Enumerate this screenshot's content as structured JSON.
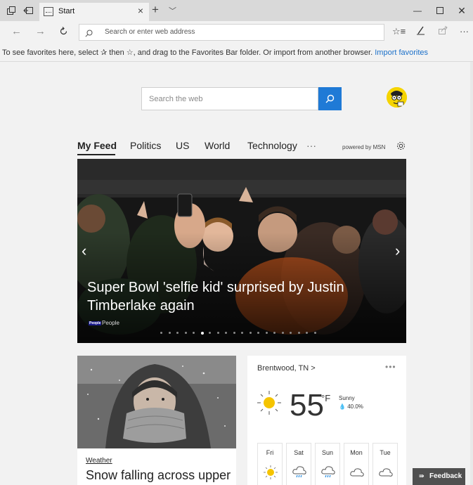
{
  "tab": {
    "title": "Start"
  },
  "address": {
    "placeholder": "Search or enter web address"
  },
  "favbar": {
    "text": "To see favorites here, select ✰ then ☆, and drag to the Favorites Bar folder. Or import from another browser.",
    "link": "Import favorites"
  },
  "search": {
    "placeholder": "Search the web"
  },
  "feed": {
    "tabs": [
      "My Feed",
      "Politics",
      "US",
      "World",
      "Technology",
      "···"
    ],
    "powered": "powered by MSN"
  },
  "hero": {
    "headline": "Super Bowl 'selfie kid' surprised by Justin Timberlake again",
    "source_logo": "People",
    "source": "People",
    "slide_count": 20,
    "active_slide": 5
  },
  "news_card": {
    "category": "Weather",
    "title": "Snow falling across upper"
  },
  "weather": {
    "location": "Brentwood, TN >",
    "more": "•••",
    "temp": "55",
    "unit": "°F",
    "condition": "Sunny",
    "precip": "40.0%",
    "forecast": [
      {
        "day": "Fri",
        "icon": "sun-icon"
      },
      {
        "day": "Sat",
        "icon": "rain-icon"
      },
      {
        "day": "Sun",
        "icon": "rain-icon"
      },
      {
        "day": "Mon",
        "icon": "cloud-icon"
      },
      {
        "day": "Tue",
        "icon": "cloud-icon"
      }
    ]
  },
  "feedback": {
    "label": "Feedback"
  },
  "colors": {
    "accent": "#1f7ad6",
    "link": "#1a6fc9",
    "sun": "#f5c400"
  }
}
